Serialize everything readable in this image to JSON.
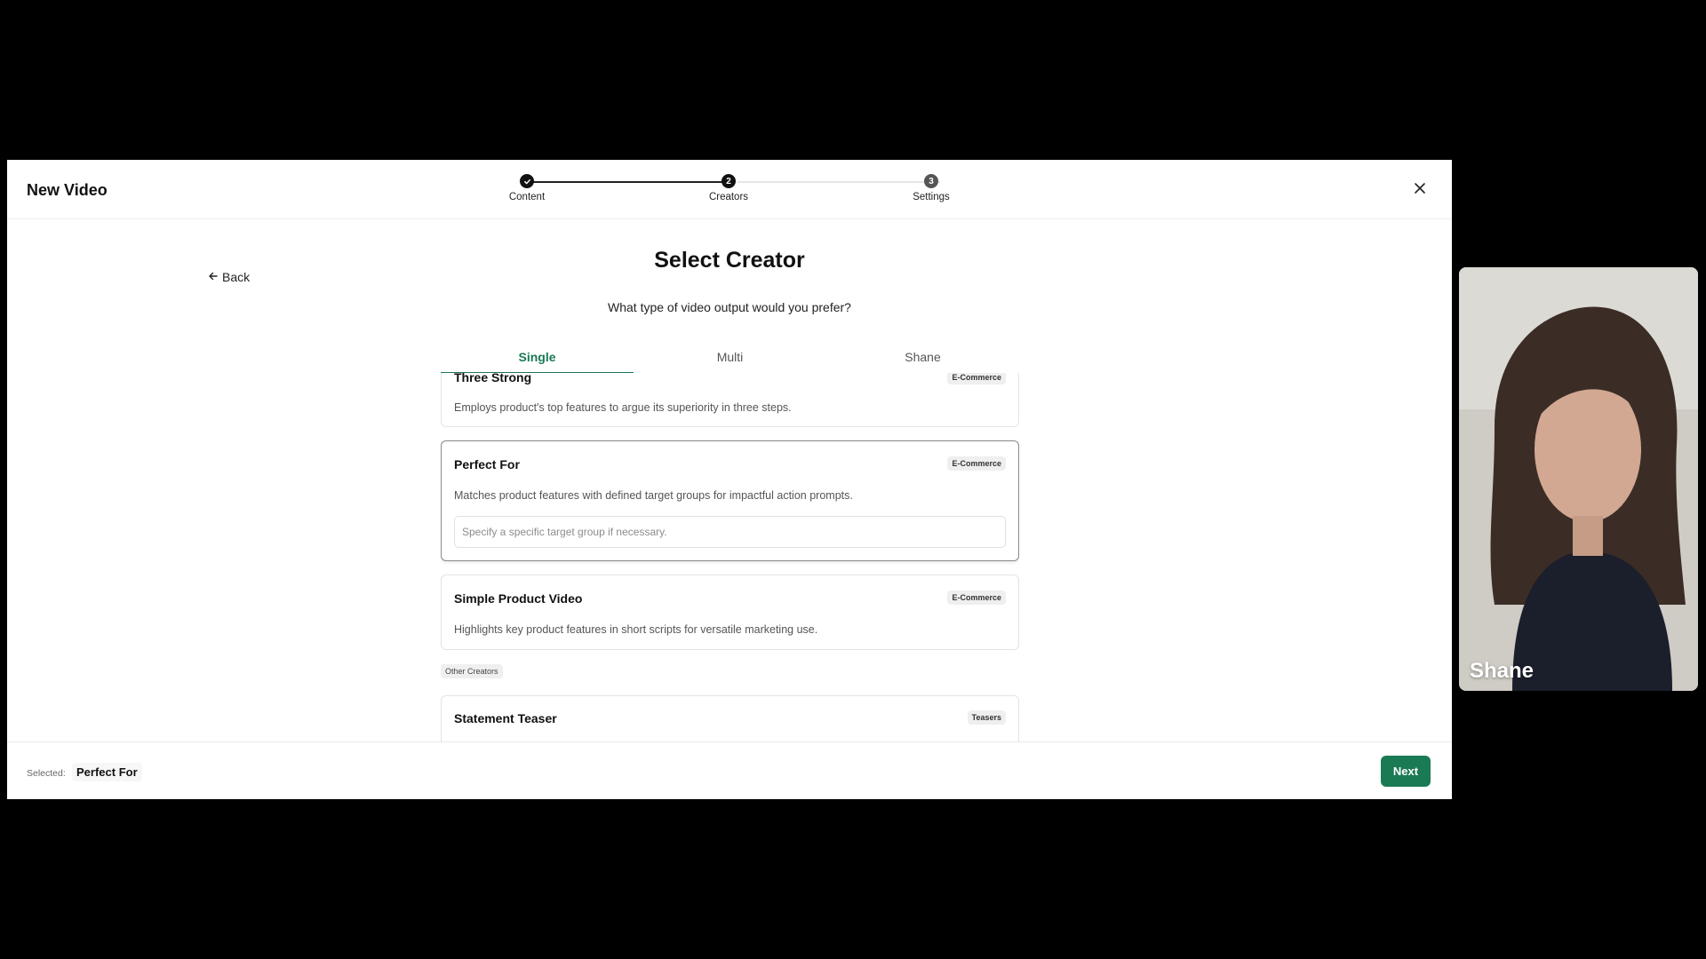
{
  "app": {
    "title": "New Video",
    "close_icon": "close-icon"
  },
  "stepper": {
    "steps": [
      {
        "label": "Content",
        "state": "done",
        "marker": ""
      },
      {
        "label": "Creators",
        "state": "current",
        "marker": "2"
      },
      {
        "label": "Settings",
        "state": "upcoming",
        "marker": "3"
      }
    ]
  },
  "page": {
    "back_label": "Back",
    "title": "Select Creator",
    "subtitle": "What type of video output would you prefer?"
  },
  "tabs": [
    {
      "label": "Single",
      "active": true
    },
    {
      "label": "Multi",
      "active": false
    },
    {
      "label": "Shane",
      "active": false
    }
  ],
  "cards": [
    {
      "title": "Three Strong",
      "badge": "E-Commerce",
      "description": "Employs product's top features to argue its superiority in three steps."
    },
    {
      "title": "Perfect For",
      "badge": "E-Commerce",
      "description": "Matches product features with defined target groups for impactful action prompts.",
      "input_placeholder": "Specify a specific target group if necessary.",
      "selected": true
    },
    {
      "title": "Simple Product Video",
      "badge": "E-Commerce",
      "description": "Highlights key product features in short scripts for versatile marketing use."
    },
    {
      "title": "Statement Teaser",
      "badge": "Teasers"
    }
  ],
  "section": {
    "other_creators": "Other Creators"
  },
  "footer": {
    "selected_label": "Selected:",
    "selected_value": "Perfect For",
    "next_label": "Next"
  },
  "webcam": {
    "name": "Shane"
  },
  "colors": {
    "accent": "#1a7a54",
    "background": "#000000"
  }
}
